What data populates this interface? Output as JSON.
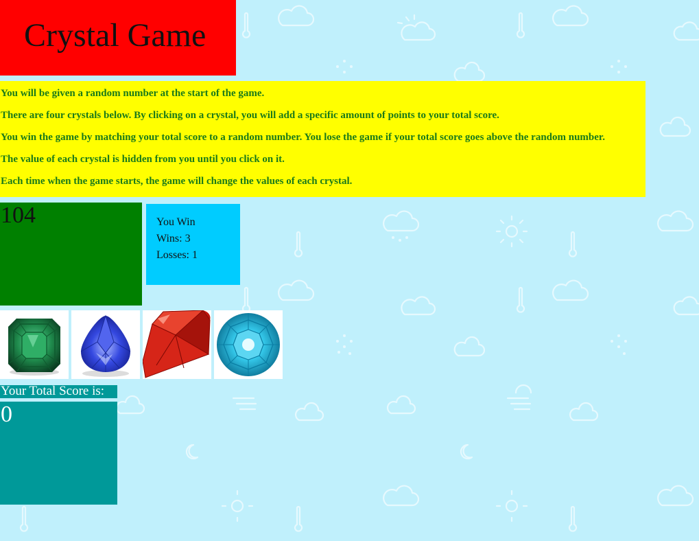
{
  "header": {
    "title": "Crystal Game"
  },
  "instructions": [
    "You will be given a random number at the start of the game.",
    "There are four crystals below. By clicking on a crystal, you will add a specific amount of points to your total score.",
    "You win the game by matching your total score to a random number. You lose the game if your total score goes above the random number.",
    "The value of each crystal is hidden from you until you click on it.",
    "Each time when the game starts, the game will change the values of each crystal."
  ],
  "target": {
    "value": "104"
  },
  "stats": {
    "status": "You Win",
    "wins": "Wins: 3",
    "losses": "Losses: 1"
  },
  "crystals": [
    {
      "name": "emerald-crystal-icon",
      "color": "#1f8a4c"
    },
    {
      "name": "sapphire-crystal-icon",
      "color": "#2a3fd0"
    },
    {
      "name": "ruby-crystal-icon",
      "color": "#c0160e"
    },
    {
      "name": "topaz-crystal-icon",
      "color": "#1fb8dc"
    }
  ],
  "score": {
    "label": "Your Total Score is:",
    "value": "0"
  },
  "colors": {
    "background": "#c0f0fc",
    "header": "#ff0000",
    "instructions": "#ffff00",
    "instruction_text": "#1a7a1a",
    "target": "#008000",
    "stats": "#00ccff",
    "score": "#009999"
  }
}
